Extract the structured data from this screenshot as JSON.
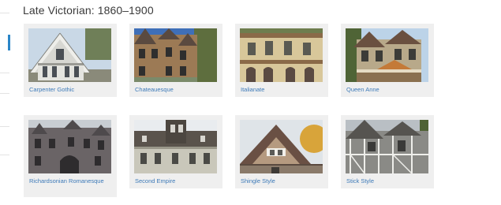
{
  "section": {
    "title": "Late Victorian: 1860–1900"
  },
  "styles": [
    {
      "label": "Carpenter Gothic",
      "image": "carpenter-gothic-house-photo"
    },
    {
      "label": "Chateauesque",
      "image": "chateauesque-house-photo"
    },
    {
      "label": "Italianate",
      "image": "italianate-house-photo"
    },
    {
      "label": "Queen Anne",
      "image": "queen-anne-house-photo"
    },
    {
      "label": "Richardsonian Romanesque",
      "image": "richardsonian-romanesque-house-photo"
    },
    {
      "label": "Second Empire",
      "image": "second-empire-house-photo"
    },
    {
      "label": "Shingle Style",
      "image": "shingle-style-house-photo"
    },
    {
      "label": "Stick Style",
      "image": "stick-style-house-photo"
    }
  ]
}
